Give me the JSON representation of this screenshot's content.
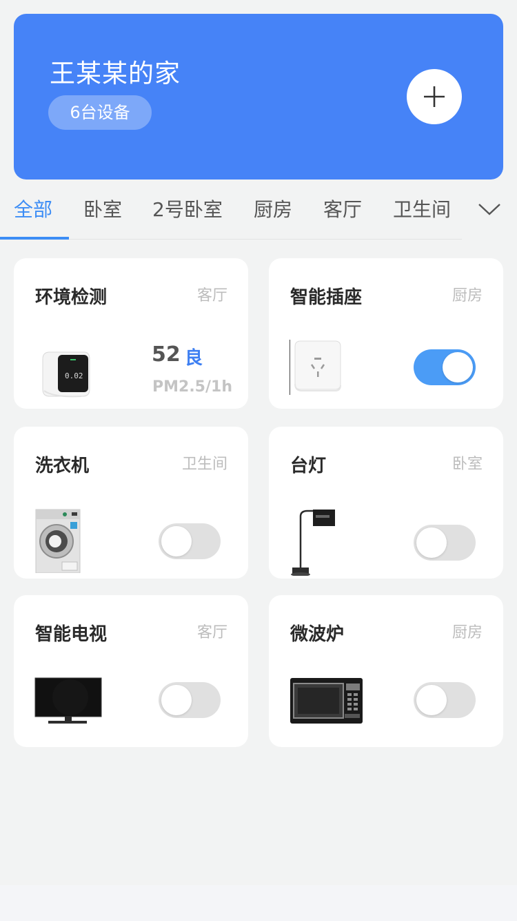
{
  "home": {
    "title": "王某某的家",
    "device_count": "6台设备",
    "add_icon": "plus-icon",
    "color": "#4683f7"
  },
  "tabs": {
    "items": [
      "全部",
      "卧室",
      "2号卧室",
      "厨房",
      "客厅",
      "卫生间"
    ],
    "active_index": 0,
    "more_icon": "chevron-down-icon",
    "accent": "#3d8df5"
  },
  "devices": [
    {
      "name": "环境检测",
      "room": "客厅",
      "icon": "air-monitor-icon",
      "reading": "52",
      "grade": "良",
      "unit": "PM2.5/1h"
    },
    {
      "name": "智能插座",
      "room": "厨房",
      "icon": "smart-plug-icon",
      "on": true
    },
    {
      "name": "洗衣机",
      "room": "卫生间",
      "icon": "washing-machine-icon",
      "on": false
    },
    {
      "name": "台灯",
      "room": "卧室",
      "icon": "desk-lamp-icon",
      "on": false
    },
    {
      "name": "智能电视",
      "room": "客厅",
      "icon": "tv-icon",
      "on": false
    },
    {
      "name": "微波炉",
      "room": "厨房",
      "icon": "microwave-icon",
      "on": false
    }
  ]
}
